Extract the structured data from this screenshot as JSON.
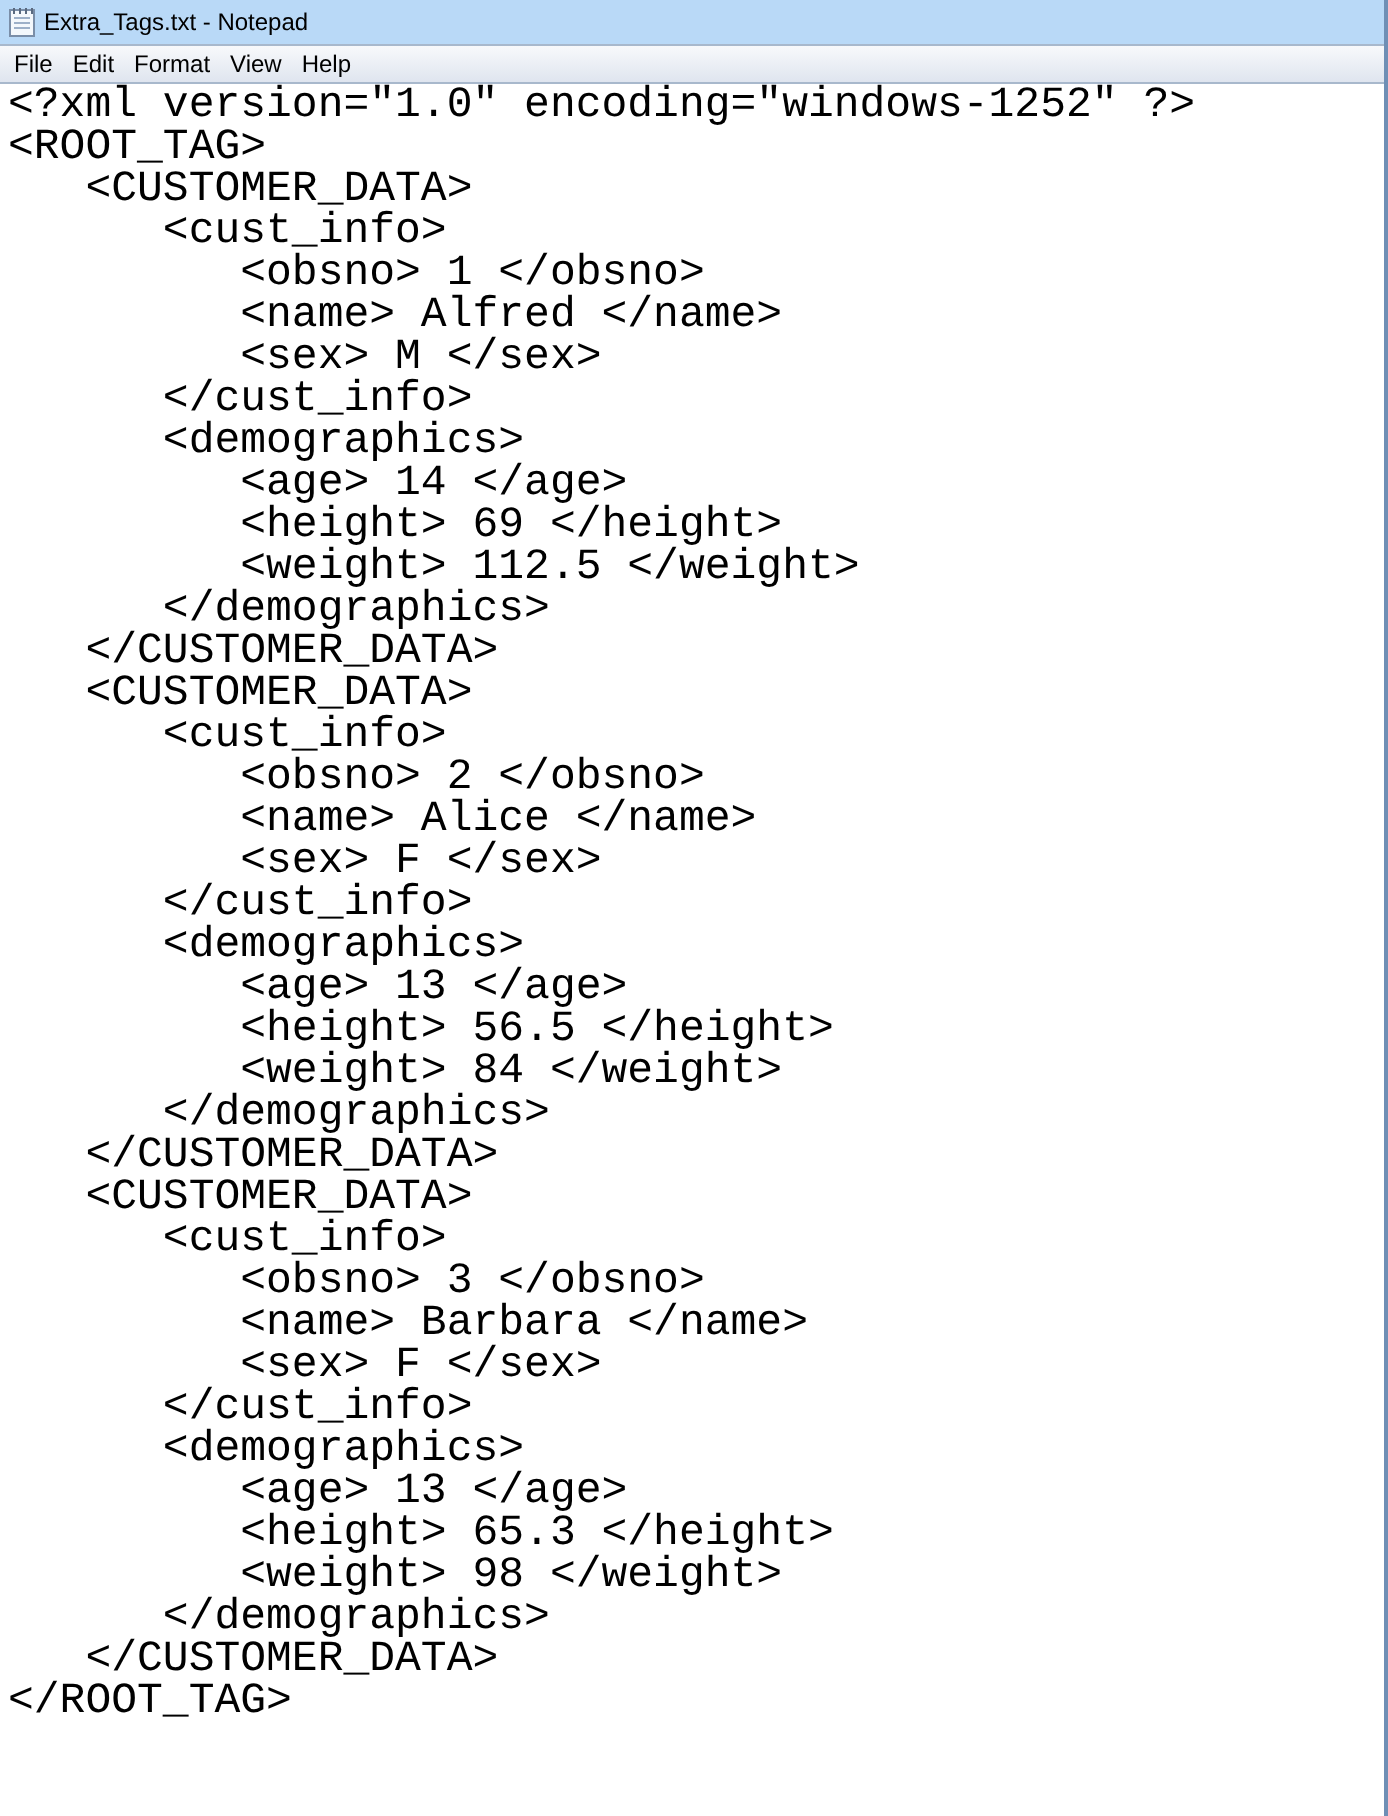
{
  "window": {
    "title": "Extra_Tags.txt - Notepad"
  },
  "menu": [
    "File",
    "Edit",
    "Format",
    "View",
    "Help"
  ],
  "lines": [
    "<?xml version=\"1.0\" encoding=\"windows-1252\" ?>",
    "<ROOT_TAG>",
    "   <CUSTOMER_DATA>",
    "      <cust_info>",
    "         <obsno> 1 </obsno>",
    "         <name> Alfred </name>",
    "         <sex> M </sex>",
    "      </cust_info>",
    "      <demographics>",
    "         <age> 14 </age>",
    "         <height> 69 </height>",
    "         <weight> 112.5 </weight>",
    "      </demographics>",
    "   </CUSTOMER_DATA>",
    "   <CUSTOMER_DATA>",
    "      <cust_info>",
    "         <obsno> 2 </obsno>",
    "         <name> Alice </name>",
    "         <sex> F </sex>",
    "      </cust_info>",
    "      <demographics>",
    "         <age> 13 </age>",
    "         <height> 56.5 </height>",
    "         <weight> 84 </weight>",
    "      </demographics>",
    "   </CUSTOMER_DATA>",
    "   <CUSTOMER_DATA>",
    "      <cust_info>",
    "         <obsno> 3 </obsno>",
    "         <name> Barbara </name>",
    "         <sex> F </sex>",
    "      </cust_info>",
    "      <demographics>",
    "         <age> 13 </age>",
    "         <height> 65.3 </height>",
    "         <weight> 98 </weight>",
    "      </demographics>",
    "   </CUSTOMER_DATA>",
    "</ROOT_TAG>"
  ]
}
